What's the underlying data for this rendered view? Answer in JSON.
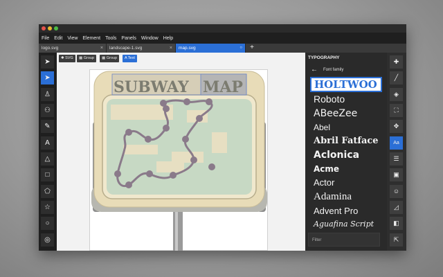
{
  "menu": [
    "File",
    "Edit",
    "View",
    "Element",
    "Tools",
    "Panels",
    "Window",
    "Help"
  ],
  "tabs": [
    {
      "label": "logo.svg",
      "close": "×"
    },
    {
      "label": "landscape-1.svg",
      "close": "×"
    },
    {
      "label": "map.svg",
      "close": "○"
    }
  ],
  "new_tab": "+",
  "context_bar": [
    "SVG",
    "Group",
    "Group",
    "Text"
  ],
  "left_tools": [
    "select-arrow-icon",
    "direct-select-icon",
    "person-icon",
    "people-icon",
    "pencil-icon",
    "text-tool-icon",
    "triangle-icon",
    "rectangle-icon",
    "pentagon-icon",
    "star-icon",
    "circle-icon",
    "target-icon"
  ],
  "left_tool_glyphs": [
    "➤",
    "➤",
    "♙",
    "⚇",
    "✎",
    "A",
    "△",
    "□",
    "⬠",
    "☆",
    "○",
    "◎"
  ],
  "sign_text": {
    "word1": "SUBWAY",
    "word2": "MAP"
  },
  "panel": {
    "title": "TYPOGRAPHY",
    "back": "←",
    "subtitle": "Font family",
    "fonts": [
      "HOLTWOO",
      "Roboto",
      "ABeeZee",
      "Abel",
      "Abril Fatface",
      "Aclonica",
      "Acme",
      "Actor",
      "Adamina",
      "Advent Pro",
      "Aguafina Script"
    ],
    "filter_placeholder": "Filter"
  },
  "right_tools": [
    "paint-bucket-icon",
    "brush-icon",
    "layers-icon",
    "fullscreen-icon",
    "move-icon",
    "font-size-icon",
    "list-icon",
    "mask-icon",
    "theatre-icon",
    "ruler-icon",
    "boolean-icon",
    "export-icon"
  ],
  "right_tool_glyphs": [
    "✚",
    "╱",
    "◈",
    "⛶",
    "✥",
    "Aa",
    "☰",
    "▣",
    "☺",
    "◿",
    "◧",
    "⇱"
  ],
  "colors": {
    "accent": "#2b6fd6",
    "sign_frame": "#e8dcb8",
    "map_green": "#c7d9c4",
    "route": "#8a7a8a"
  }
}
